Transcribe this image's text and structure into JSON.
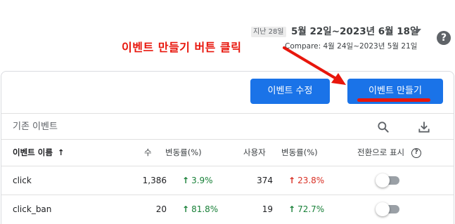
{
  "header": {
    "period_badge": "지난 28일",
    "date_range": "5월 22일~2023년 6월 18일",
    "compare": "Compare: 4월 24일~2023년 5월 21일",
    "help_symbol": "?"
  },
  "annotation": {
    "text": "이벤트 만들기 버튼 클릭",
    "color": "#e8160c"
  },
  "toolbar": {
    "edit_label": "이벤트 수정",
    "create_label": "이벤트 만들기",
    "accent": "#1a73e8"
  },
  "section": {
    "title": "기존 이벤트",
    "icons": [
      "search-icon",
      "download-icon"
    ]
  },
  "table": {
    "headers": {
      "name": "이벤트 이름",
      "count": "수",
      "count_change": "변동률(%)",
      "users": "사용자",
      "users_change": "변동률(%)",
      "mark_conversion": "전환으로 표시",
      "help_symbol": "?"
    },
    "rows": [
      {
        "name": "click",
        "count": "1,386",
        "count_change": "3.9%",
        "count_change_dir": "up",
        "users": "374",
        "users_change": "23.8%",
        "users_change_dir": "up",
        "conversion_on": false
      },
      {
        "name": "click_ban",
        "count": "20",
        "count_change": "81.8%",
        "count_change_dir": "up",
        "users": "19",
        "users_change": "72.7%",
        "users_change_dir": "up",
        "conversion_on": false
      }
    ],
    "colors": {
      "positive": "#188038",
      "negative": "#d93025"
    }
  }
}
